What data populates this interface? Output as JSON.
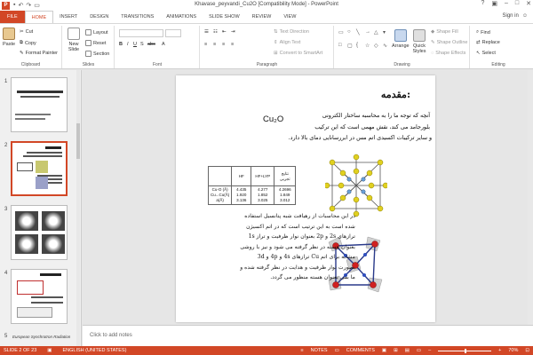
{
  "window": {
    "title": "Khavase_peyvandi_Cu2O [Compatibility Mode] - PowerPoint",
    "user": "Sign in"
  },
  "tabs": [
    "FILE",
    "HOME",
    "INSERT",
    "DESIGN",
    "TRANSITIONS",
    "ANIMATIONS",
    "SLIDE SHOW",
    "REVIEW",
    "VIEW"
  ],
  "ribbon": {
    "clipboard": {
      "label": "Clipboard",
      "paste": "Paste",
      "cut": "Cut",
      "copy": "Copy",
      "format_painter": "Format Painter"
    },
    "slides": {
      "label": "Slides",
      "new_slide": "New Slide",
      "layout": "Layout",
      "reset": "Reset",
      "section": "Section"
    },
    "font": {
      "label": "Font"
    },
    "paragraph": {
      "label": "Paragraph",
      "text_direction": "Text Direction",
      "align_text": "Align Text",
      "smartart": "Convert to SmartArt"
    },
    "drawing": {
      "label": "Drawing",
      "arrange": "Arrange",
      "quick_styles": "Quick Styles",
      "shape_fill": "Shape Fill",
      "shape_outline": "Shape Outline",
      "shape_effects": "Shape Effects"
    },
    "editing": {
      "label": "Editing",
      "find": "Find",
      "replace": "Replace",
      "select": "Select"
    }
  },
  "slides_panel": {
    "numbers": [
      "1",
      "2",
      "3",
      "4",
      "5"
    ],
    "thumb5_text": "European Synchrotron Radiation"
  },
  "slide": {
    "heading": "مقدمه:",
    "formula": "Cu₂O",
    "intro_lines": [
      "آنچه که توجه ما را به محاسبه ساختار الکترونی",
      "بلورجامد می کند، نقش مهمی است که این ترکیب",
      "و سایر ترکیبات اکسیدی اتم مس در ابررسانایی دمای بالا دارد."
    ],
    "table": {
      "header": [
        "HF",
        "HF+LYP",
        "نتایج تجربی"
      ],
      "row_labels": [
        "Cu-O (Å)",
        "Cu...Cu(Å)",
        "a(Å)"
      ],
      "hf": [
        "4.435",
        "1.920",
        "3.136"
      ],
      "hflyp": [
        "4.277",
        "1.852",
        "3.025"
      ],
      "exp": [
        "4.2696",
        "1.849",
        "3.012"
      ]
    },
    "body_lines": [
      "در این محاسبات از رهیافت شبه پتانسیل استفاده",
      "شده است به این ترتیب است که در اتم اکسیژن",
      "ترازهای 2s و 2p بعنوان نوار ظرفیت و تراز 1s",
      "بعنوان هسته در نظر گرفته می شود و نیز با روشی",
      "مشابه برای اتم Cu ترازهای 4s و 4p و 3d",
      "بصورت نوار ظرفیت و هدایت در نظر گرفته شده و",
      "ما بقی بعنوان هسته منظور می گردد."
    ]
  },
  "notes": {
    "placeholder": "Click to add notes"
  },
  "status": {
    "slide": "SLIDE 2 OF 23",
    "language": "ENGLISH (UNITED STATES)",
    "notes": "NOTES",
    "comments": "COMMENTS",
    "zoom": "70%"
  },
  "colors": {
    "accent": "#d24726"
  }
}
